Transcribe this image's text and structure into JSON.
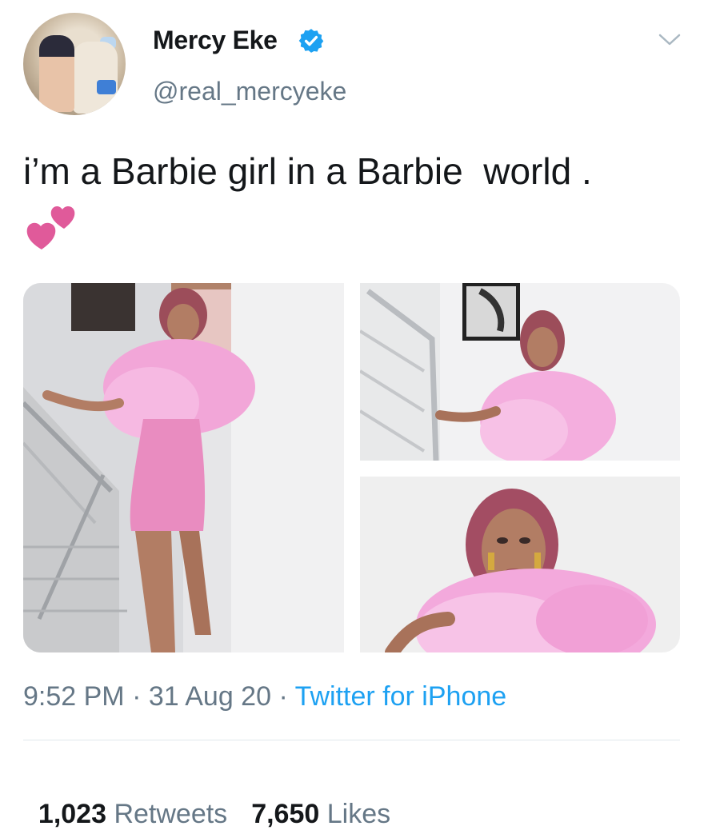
{
  "user": {
    "name": "Mercy Eke",
    "handle": "@real_mercyeke",
    "verified": true,
    "avatar_icon": "profile-photo"
  },
  "tweet": {
    "text": "i’m a Barbie girl in a Barbie  world .",
    "emoji_icon": "two-hearts-icon",
    "media_count": 3
  },
  "meta": {
    "time": "9:52 PM",
    "sep1": " · ",
    "date": "31 Aug 20",
    "sep2": " · ",
    "source": "Twitter for iPhone"
  },
  "stats": {
    "retweets_count": "1,023",
    "retweets_label": "Retweets",
    "likes_count": "7,650",
    "likes_label": "Likes"
  },
  "colors": {
    "accent": "#1da1f2",
    "secondary_text": "#657786",
    "pink": "#e05a9a"
  }
}
